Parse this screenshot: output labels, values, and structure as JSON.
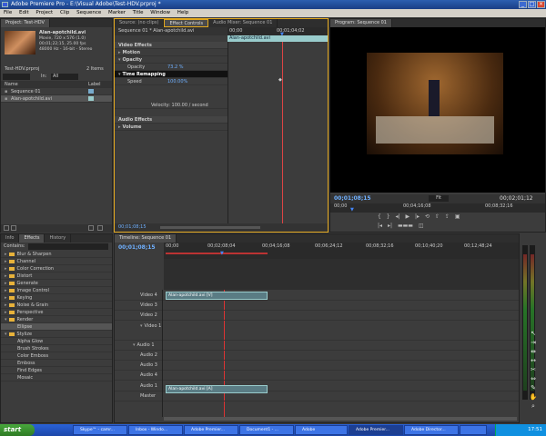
{
  "title": "Adobe Premiere Pro - E:\\Visual Adobe\\Test-HDV.prproj *",
  "menu": [
    "File",
    "Edit",
    "Project",
    "Clip",
    "Sequence",
    "Marker",
    "Title",
    "Window",
    "Help"
  ],
  "project": {
    "tab": "Project: Test-HDV",
    "clip_name": "Alan-apotchild.avi",
    "clip_info": [
      "Movie, 720 x 576 (1.0)",
      "00;01;22;15, 25.00 fps",
      "48000 Hz - 16-bit - Stereo"
    ],
    "file": "Test-HDV.prproj",
    "items_count": "2 Items",
    "in_label": "In:",
    "in_value": "All",
    "col_name": "Name",
    "col_label": "Label",
    "items": [
      "Sequence 01",
      "Alan-apotchild.avi"
    ]
  },
  "effect_controls": {
    "tabs": [
      "Source: (no clips)",
      "Effect Controls",
      "Audio Mixer: Sequence 01"
    ],
    "seq_label": "Sequence 01 * Alan-apotchild.avi",
    "ruler": [
      "00;00",
      "00;01;04;02"
    ],
    "clip_bar": "Alan-apotchild.avi",
    "video_effects": "Video Effects",
    "motion": "Motion",
    "opacity": "Opacity",
    "opacity_param": "Opacity",
    "opacity_value": "73.2 %",
    "time_remap": "Time Remapping",
    "speed_label": "Speed",
    "speed_value": "100.00%",
    "velocity": "Velocity: 100.00 / second",
    "audio_effects": "Audio Effects",
    "volume": "Volume",
    "timecode": "00;01;08;15"
  },
  "program": {
    "tab": "Program: Sequence 01",
    "timecode_left": "00;01;08;15",
    "fit": "Fit",
    "timecode_right": "00;02;01;12",
    "ruler": [
      "00;00",
      "00;04;16;08",
      "00;08;32;16"
    ]
  },
  "effects": {
    "tabs": [
      "Info",
      "Effects",
      "History"
    ],
    "contains": "Contains:",
    "folders": [
      "Blur & Sharpen",
      "Channel",
      "Color Correction",
      "Distort",
      "Generate",
      "Image Control",
      "Keying",
      "Noise & Grain",
      "Perspective",
      "Render",
      "Ellipse",
      "Stylize",
      "Alpha Glow",
      "Brush Strokes",
      "Color Emboss",
      "Emboss",
      "Find Edges",
      "Mosaic"
    ]
  },
  "timeline": {
    "tab": "Timeline: Sequence 01",
    "timecode": "00;01;08;15",
    "ruler": [
      "00;00",
      "00;02;08;04",
      "00;04;16;08",
      "00;06;24;12",
      "00;08;32;16",
      "00;10;40;20",
      "00;12;48;24"
    ],
    "tracks": [
      "Video 4",
      "Video 3",
      "Video 2",
      "Video 1",
      "Audio 1",
      "Audio 2",
      "Audio 3",
      "Audio 4",
      "Audio 1",
      "Master"
    ],
    "video_clip": "Alan-apotchild.avi [V]",
    "audio_clip": "Alan-apotchild.avi [A]"
  },
  "taskbar": {
    "start": "start",
    "buttons": [
      "Skype™ - camr...",
      "Inbox - Windo...",
      "Adobe Premier...",
      "Document1 - ...",
      "Adobe",
      "Adobe Premier...",
      "Adobe Director...",
      ""
    ],
    "clock": "17:51"
  }
}
